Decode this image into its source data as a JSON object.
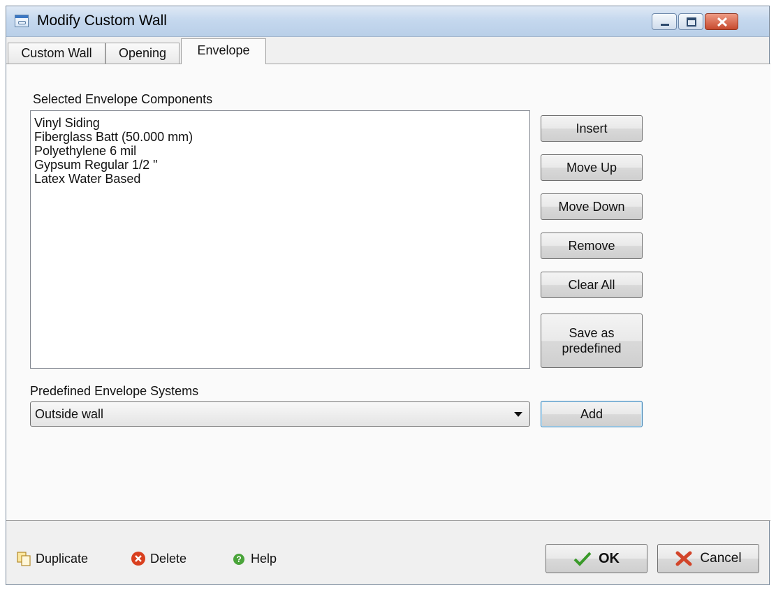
{
  "window": {
    "title": "Modify Custom Wall",
    "icon": "app-window-icon",
    "controls": [
      "minimize-icon",
      "maximize-icon",
      "close-icon"
    ]
  },
  "tabs": [
    {
      "label": "Custom Wall",
      "active": false
    },
    {
      "label": "Opening",
      "active": false
    },
    {
      "label": "Envelope",
      "active": true
    }
  ],
  "envelope": {
    "components_label": "Selected Envelope Components",
    "components": [
      "Vinyl Siding",
      "Fiberglass Batt (50.000 mm)",
      "Polyethylene 6 mil",
      "Gypsum Regular 1/2 \"",
      "Latex Water Based"
    ],
    "buttons": {
      "insert": "Insert",
      "move_up": "Move Up",
      "move_down": "Move Down",
      "remove": "Remove",
      "clear_all": "Clear All",
      "save_line1": "Save as",
      "save_line2": "predefined"
    },
    "predefined_label": "Predefined Envelope Systems",
    "predefined_selected": "Outside wall",
    "add_label": "Add"
  },
  "footer": {
    "duplicate": "Duplicate",
    "delete": "Delete",
    "help": "Help",
    "ok": "OK",
    "cancel": "Cancel"
  },
  "colors": {
    "titlebar": "#c5d8ee",
    "close_button": "#c74a2e",
    "ok_check": "#3a9a2a",
    "cancel_x": "#d2452a",
    "help_icon": "#4aa43a",
    "delete_icon": "#d9401f"
  }
}
